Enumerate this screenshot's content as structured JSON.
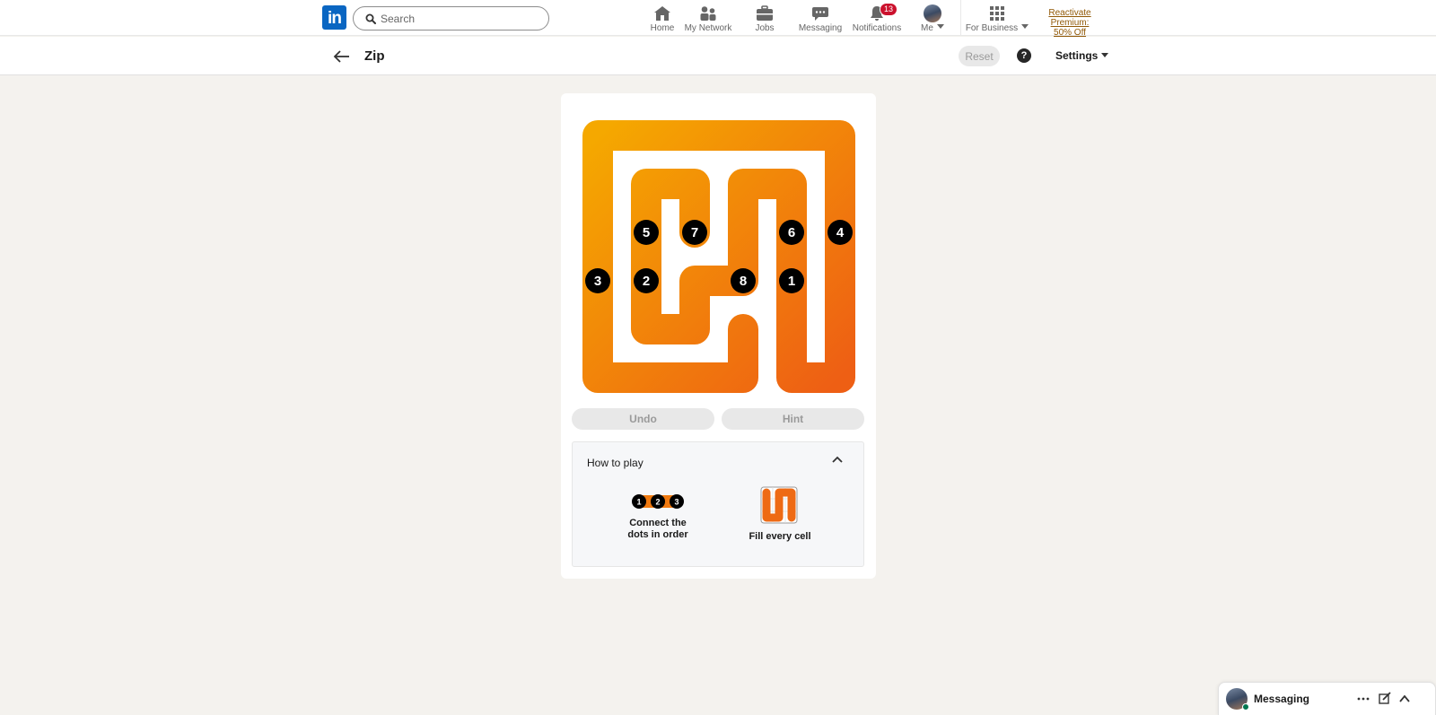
{
  "nav": {
    "logo_text": "in",
    "search_placeholder": "Search",
    "items": [
      {
        "label": "Home",
        "icon": "home-icon"
      },
      {
        "label": "My Network",
        "icon": "people-icon"
      },
      {
        "label": "Jobs",
        "icon": "briefcase-icon"
      },
      {
        "label": "Messaging",
        "icon": "chat-icon"
      },
      {
        "label": "Notifications",
        "icon": "bell-icon",
        "badge": "13"
      },
      {
        "label": "Me",
        "icon": "avatar"
      },
      {
        "label": "For Business",
        "icon": "grid-icon"
      }
    ],
    "premium_line1": "Reactivate Premium:",
    "premium_line2": "50% Off"
  },
  "subheader": {
    "title": "Zip",
    "reset_label": "Reset",
    "help_label": "?",
    "settings_label": "Settings"
  },
  "game": {
    "grid_size": 6,
    "path_order": [
      [
        4,
        3
      ],
      [
        5,
        3
      ],
      [
        5,
        2
      ],
      [
        5,
        1
      ],
      [
        5,
        0
      ],
      [
        4,
        0
      ],
      [
        3,
        0
      ],
      [
        2,
        0
      ],
      [
        1,
        0
      ],
      [
        0,
        0
      ],
      [
        0,
        1
      ],
      [
        0,
        2
      ],
      [
        0,
        3
      ],
      [
        0,
        4
      ],
      [
        0,
        5
      ],
      [
        1,
        5
      ],
      [
        2,
        5
      ],
      [
        3,
        5
      ],
      [
        4,
        5
      ],
      [
        5,
        5
      ],
      [
        5,
        4
      ],
      [
        4,
        4
      ],
      [
        3,
        4
      ],
      [
        2,
        4
      ],
      [
        1,
        4
      ],
      [
        1,
        3
      ],
      [
        2,
        3
      ],
      [
        3,
        3
      ],
      [
        3,
        2
      ],
      [
        4,
        2
      ],
      [
        4,
        1
      ],
      [
        3,
        1
      ],
      [
        2,
        1
      ],
      [
        1,
        1
      ],
      [
        1,
        2
      ],
      [
        2,
        2
      ]
    ],
    "dots": [
      {
        "n": "1",
        "row": 3,
        "col": 4
      },
      {
        "n": "2",
        "row": 3,
        "col": 1
      },
      {
        "n": "3",
        "row": 3,
        "col": 0
      },
      {
        "n": "4",
        "row": 2,
        "col": 5
      },
      {
        "n": "5",
        "row": 2,
        "col": 1
      },
      {
        "n": "6",
        "row": 2,
        "col": 4
      },
      {
        "n": "7",
        "row": 2,
        "col": 2
      },
      {
        "n": "8",
        "row": 3,
        "col": 3
      }
    ],
    "colors": {
      "light": "#f5a800",
      "dark": "#ee5f14",
      "dot": "#000000"
    },
    "undo_label": "Undo",
    "hint_label": "Hint"
  },
  "how_to_play": {
    "title": "How to play",
    "connect_line1": "Connect the",
    "connect_line2": "dots in order",
    "fill_label": "Fill every cell",
    "demo_dots": [
      "1",
      "2",
      "3"
    ]
  },
  "messaging": {
    "title": "Messaging"
  }
}
